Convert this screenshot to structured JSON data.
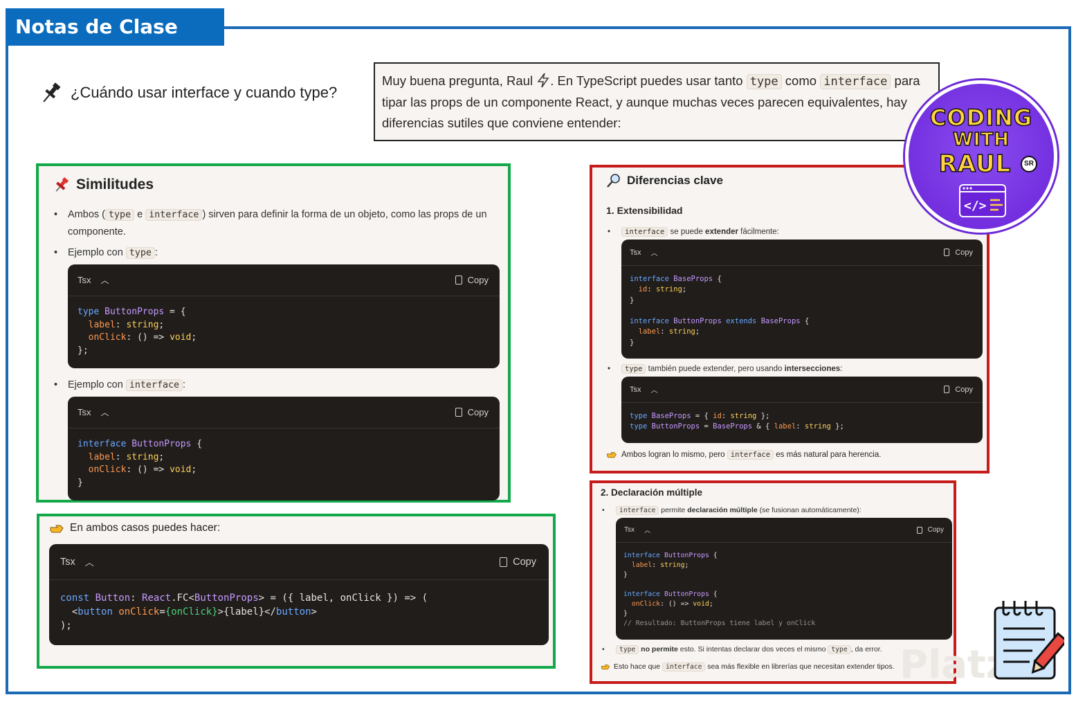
{
  "header": {
    "title": "Notas de Clase"
  },
  "question": {
    "text": "¿Cuándo usar interface y cuando type?"
  },
  "answer": {
    "line1_a": "Muy buena pregunta, Raul ",
    "line1_b": ". En TypeScript puedes usar tanto ",
    "code_type": "type",
    "line1_c": " como ",
    "code_interface": "interface",
    "line1_d": " para",
    "line2": "tipar las props de un componente React, y aunque muchas veces parecen equivalentes, hay",
    "line3": "diferencias sutiles que conviene entender:"
  },
  "similitudes": {
    "title": "Similitudes",
    "b1_a": "Ambos (",
    "b1_code1": "type",
    "b1_b": " e ",
    "b1_code2": "interface",
    "b1_c": ") sirven para definir la forma de un objeto, como las props de un",
    "b1_d": "componente.",
    "b2_a": "Ejemplo con ",
    "b2_code": "type",
    "b2_b": ":",
    "b3_a": "Ejemplo con ",
    "b3_code": "interface",
    "b3_b": ":",
    "code_lang": "Tsx",
    "copy_label": "Copy",
    "code1": [
      "type ButtonProps = {",
      "  label: string;",
      "  onClick: () => void;",
      "};"
    ],
    "code2": [
      "interface ButtonProps {",
      "  label: string;",
      "  onClick: () => void;",
      "}"
    ]
  },
  "ambos": {
    "title": "En ambos casos puedes hacer:",
    "code_lang": "Tsx",
    "copy_label": "Copy",
    "code": [
      "const Button: React.FC<ButtonProps> = ({ label, onClick }) => (",
      "  <button onClick={onClick}>{label}</button>",
      ");"
    ]
  },
  "diferencias": {
    "title": "Diferencias clave",
    "sub1": "1. Extensibilidad",
    "b1_code": "interface",
    "b1_a": " se puede ",
    "b1_bold": "extender",
    "b1_b": " fácilmente:",
    "b2_code": "type",
    "b2_a": " también puede extender, pero usando ",
    "b2_bold": "intersecciones",
    "b2_b": ":",
    "note_a": "Ambos logran lo mismo, pero ",
    "note_code": "interface",
    "note_b": " es más natural para herencia.",
    "code_lang": "Tsx",
    "copy_label": "Copy",
    "code1": [
      "interface BaseProps {",
      "  id: string;",
      "}",
      "",
      "interface ButtonProps extends BaseProps {",
      "  label: string;",
      "}"
    ],
    "code2": [
      "type BaseProps = { id: string };",
      "type ButtonProps = BaseProps & { label: string };"
    ]
  },
  "declaracion": {
    "title": "2. Declaración múltiple",
    "b1_code": "interface",
    "b1_a": " permite ",
    "b1_bold": "declaración múltiple",
    "b1_b": " (se fusionan automáticamente):",
    "code_lang": "Tsx",
    "copy_label": "Copy",
    "code": [
      "interface ButtonProps {",
      "  label: string;",
      "}",
      "",
      "interface ButtonProps {",
      "  onClick: () => void;",
      "}",
      "// Resultado: ButtonProps tiene label y onClick"
    ],
    "b2_code": "type",
    "b2_bold": " no permite",
    "b2_a": " esto. Si intentas declarar dos veces el mismo ",
    "b2_code2": "type",
    "b2_b": ", da error.",
    "note_a": "Esto hace que ",
    "note_code": "interface",
    "note_b": " sea más flexible en librerías que necesitan extender tipos."
  },
  "logo": {
    "line1": "CODING",
    "line2": "WITH",
    "line3": "RAUL",
    "badge": "SR"
  },
  "watermark": "Platzi"
}
